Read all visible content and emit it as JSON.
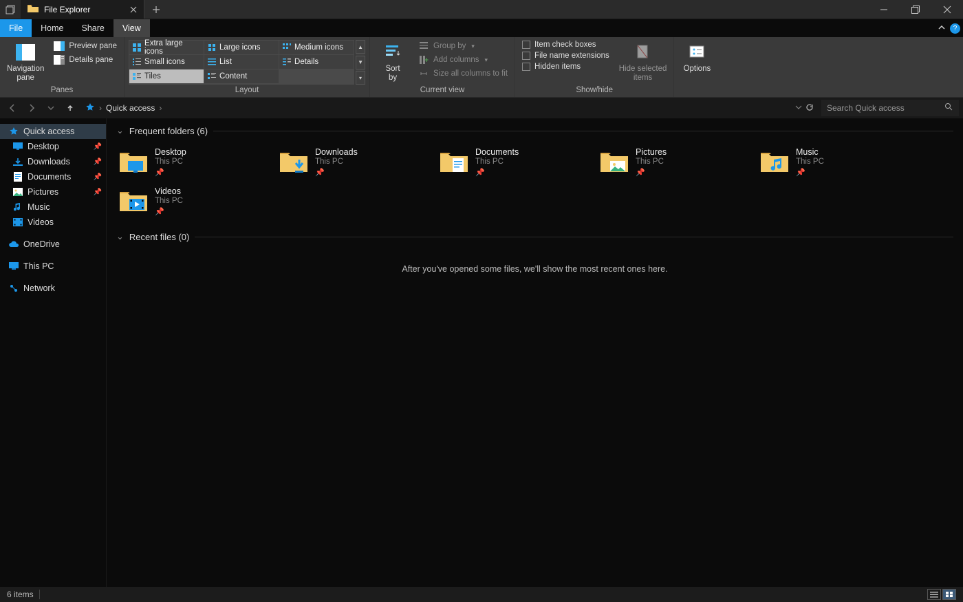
{
  "titlebar": {
    "title": "File Explorer"
  },
  "menu": {
    "file": "File",
    "home": "Home",
    "share": "Share",
    "view": "View"
  },
  "ribbon": {
    "panes": {
      "navigation": "Navigation\npane",
      "preview": "Preview pane",
      "details": "Details pane",
      "group": "Panes"
    },
    "layout": {
      "items": [
        "Extra large icons",
        "Large icons",
        "Medium icons",
        "Small icons",
        "List",
        "Details",
        "Tiles",
        "Content"
      ],
      "group": "Layout"
    },
    "currentview": {
      "sortby": "Sort\nby",
      "groupby": "Group by",
      "addcols": "Add columns",
      "sizecols": "Size all columns to fit",
      "group": "Current view"
    },
    "showhide": {
      "itemcheck": "Item check boxes",
      "fileext": "File name extensions",
      "hidden": "Hidden items",
      "hidesel": "Hide selected\nitems",
      "group": "Show/hide"
    },
    "options": "Options"
  },
  "nav": {
    "location": "Quick access",
    "search_placeholder": "Search Quick access"
  },
  "sidebar": {
    "quick": "Quick access",
    "items": [
      {
        "label": "Desktop",
        "pinned": true
      },
      {
        "label": "Downloads",
        "pinned": true
      },
      {
        "label": "Documents",
        "pinned": true
      },
      {
        "label": "Pictures",
        "pinned": true
      },
      {
        "label": "Music",
        "pinned": false
      },
      {
        "label": "Videos",
        "pinned": false
      }
    ],
    "onedrive": "OneDrive",
    "thispc": "This PC",
    "network": "Network"
  },
  "content": {
    "frequent_hdr": "Frequent folders (6)",
    "recent_hdr": "Recent files (0)",
    "recent_empty": "After you've opened some files, we'll show the most recent ones here.",
    "folders": [
      {
        "name": "Desktop",
        "loc": "This PC"
      },
      {
        "name": "Downloads",
        "loc": "This PC"
      },
      {
        "name": "Documents",
        "loc": "This PC"
      },
      {
        "name": "Pictures",
        "loc": "This PC"
      },
      {
        "name": "Music",
        "loc": "This PC"
      },
      {
        "name": "Videos",
        "loc": "This PC"
      }
    ]
  },
  "status": {
    "items": "6 items"
  }
}
